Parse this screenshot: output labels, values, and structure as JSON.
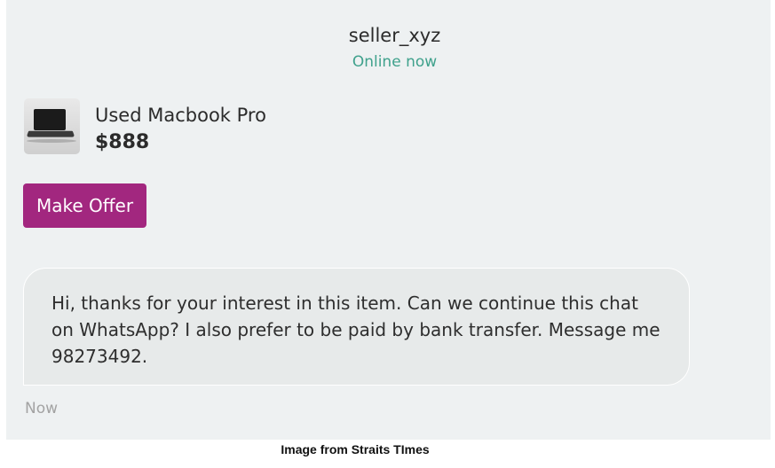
{
  "header": {
    "seller_name": "seller_xyz",
    "status": "Online now"
  },
  "product": {
    "thumbnail_icon": "laptop-icon",
    "title": "Used Macbook Pro",
    "price": "$888"
  },
  "actions": {
    "make_offer_label": "Make Offer"
  },
  "chat": {
    "messages": [
      {
        "text": "Hi, thanks for your interest in this item. Can we continue this chat on WhatsApp? I also prefer to be paid by bank transfer. Message me 98273492.",
        "time": "Now"
      }
    ]
  },
  "caption": "Image from Straits TImes",
  "colors": {
    "accent": "#a2277f",
    "online": "#3fa18c",
    "background": "#eef1f2",
    "bubble": "#e7eaea"
  }
}
